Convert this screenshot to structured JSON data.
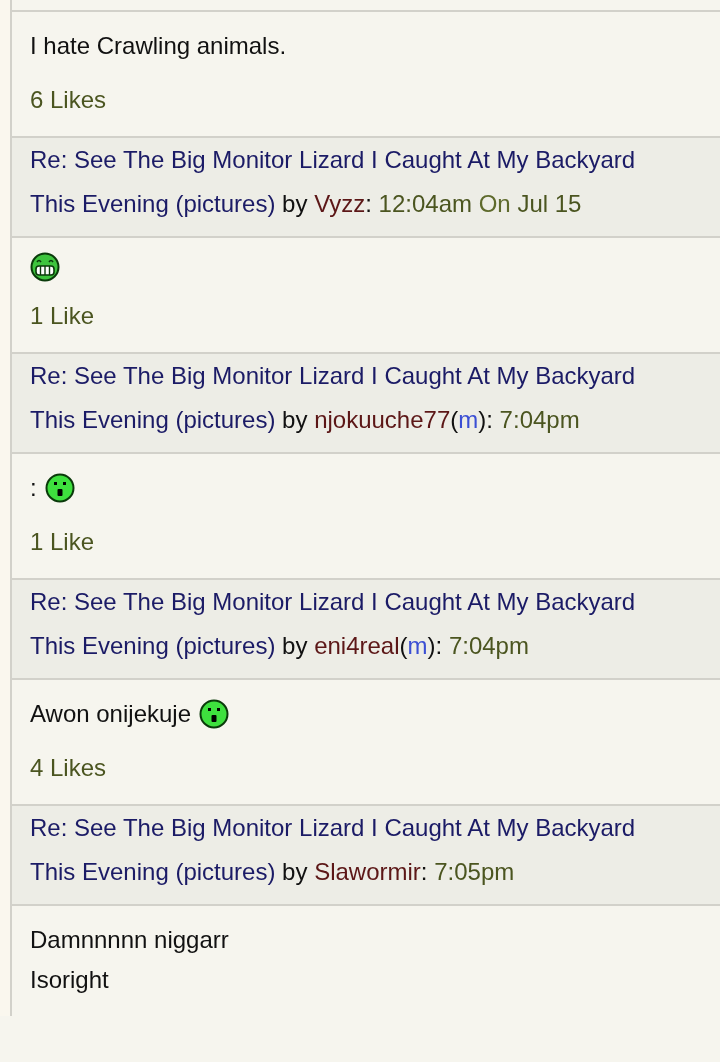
{
  "posts": [
    {
      "body": [
        [
          {
            "kind": "text",
            "text": "I hate Crawling animals."
          }
        ]
      ],
      "likes": "6 Likes"
    },
    {
      "header": [
        [
          {
            "kind": "topic",
            "text": "Re: See The Big Monitor Lizard I Caught At My Backyard"
          }
        ],
        [
          {
            "kind": "topic",
            "text": "This Evening (pictures)"
          },
          {
            "kind": "plain",
            "text": "by"
          },
          {
            "kind": "author",
            "text": "Vyzz"
          },
          {
            "kind": "punct",
            "text": ":"
          },
          {
            "kind": "time",
            "text": "12:04am"
          },
          {
            "kind": "muted",
            "text": "On"
          },
          {
            "kind": "time",
            "text": "Jul 15"
          }
        ]
      ],
      "body": [
        [
          {
            "kind": "grin"
          }
        ]
      ],
      "likes": "1 Like"
    },
    {
      "header": [
        [
          {
            "kind": "topic",
            "text": "Re: See The Big Monitor Lizard I Caught At My Backyard"
          }
        ],
        [
          {
            "kind": "topic",
            "text": "This Evening (pictures)"
          },
          {
            "kind": "plain",
            "text": "by"
          },
          {
            "kind": "author",
            "text": "njokuuche77"
          },
          {
            "kind": "punct",
            "text": "("
          },
          {
            "kind": "mod",
            "text": "m"
          },
          {
            "kind": "punct",
            "text": "):"
          },
          {
            "kind": "time",
            "text": "7:04pm"
          }
        ]
      ],
      "body": [
        [
          {
            "kind": "text",
            "text": ":"
          },
          {
            "kind": "shocked"
          }
        ]
      ],
      "likes": "1 Like"
    },
    {
      "header": [
        [
          {
            "kind": "topic",
            "text": "Re: See The Big Monitor Lizard I Caught At My Backyard"
          }
        ],
        [
          {
            "kind": "topic",
            "text": "This Evening (pictures)"
          },
          {
            "kind": "plain",
            "text": "by"
          },
          {
            "kind": "author",
            "text": "eni4real"
          },
          {
            "kind": "punct",
            "text": "("
          },
          {
            "kind": "mod",
            "text": "m"
          },
          {
            "kind": "punct",
            "text": "):"
          },
          {
            "kind": "time",
            "text": "7:04pm"
          }
        ]
      ],
      "body": [
        [
          {
            "kind": "text",
            "text": "Awon onijekuje"
          },
          {
            "kind": "shocked"
          }
        ]
      ],
      "likes": "4 Likes"
    },
    {
      "header": [
        [
          {
            "kind": "topic",
            "text": "Re: See The Big Monitor Lizard I Caught At My Backyard"
          }
        ],
        [
          {
            "kind": "topic",
            "text": "This Evening (pictures)"
          },
          {
            "kind": "plain",
            "text": "by"
          },
          {
            "kind": "author",
            "text": "Slawormir"
          },
          {
            "kind": "punct",
            "text": ":"
          },
          {
            "kind": "time",
            "text": "7:05pm"
          }
        ]
      ],
      "body": [
        [
          {
            "kind": "text",
            "text": "Damnnnnn niggarr"
          }
        ],
        [
          {
            "kind": "text",
            "text": "Isoright"
          }
        ]
      ]
    }
  ]
}
